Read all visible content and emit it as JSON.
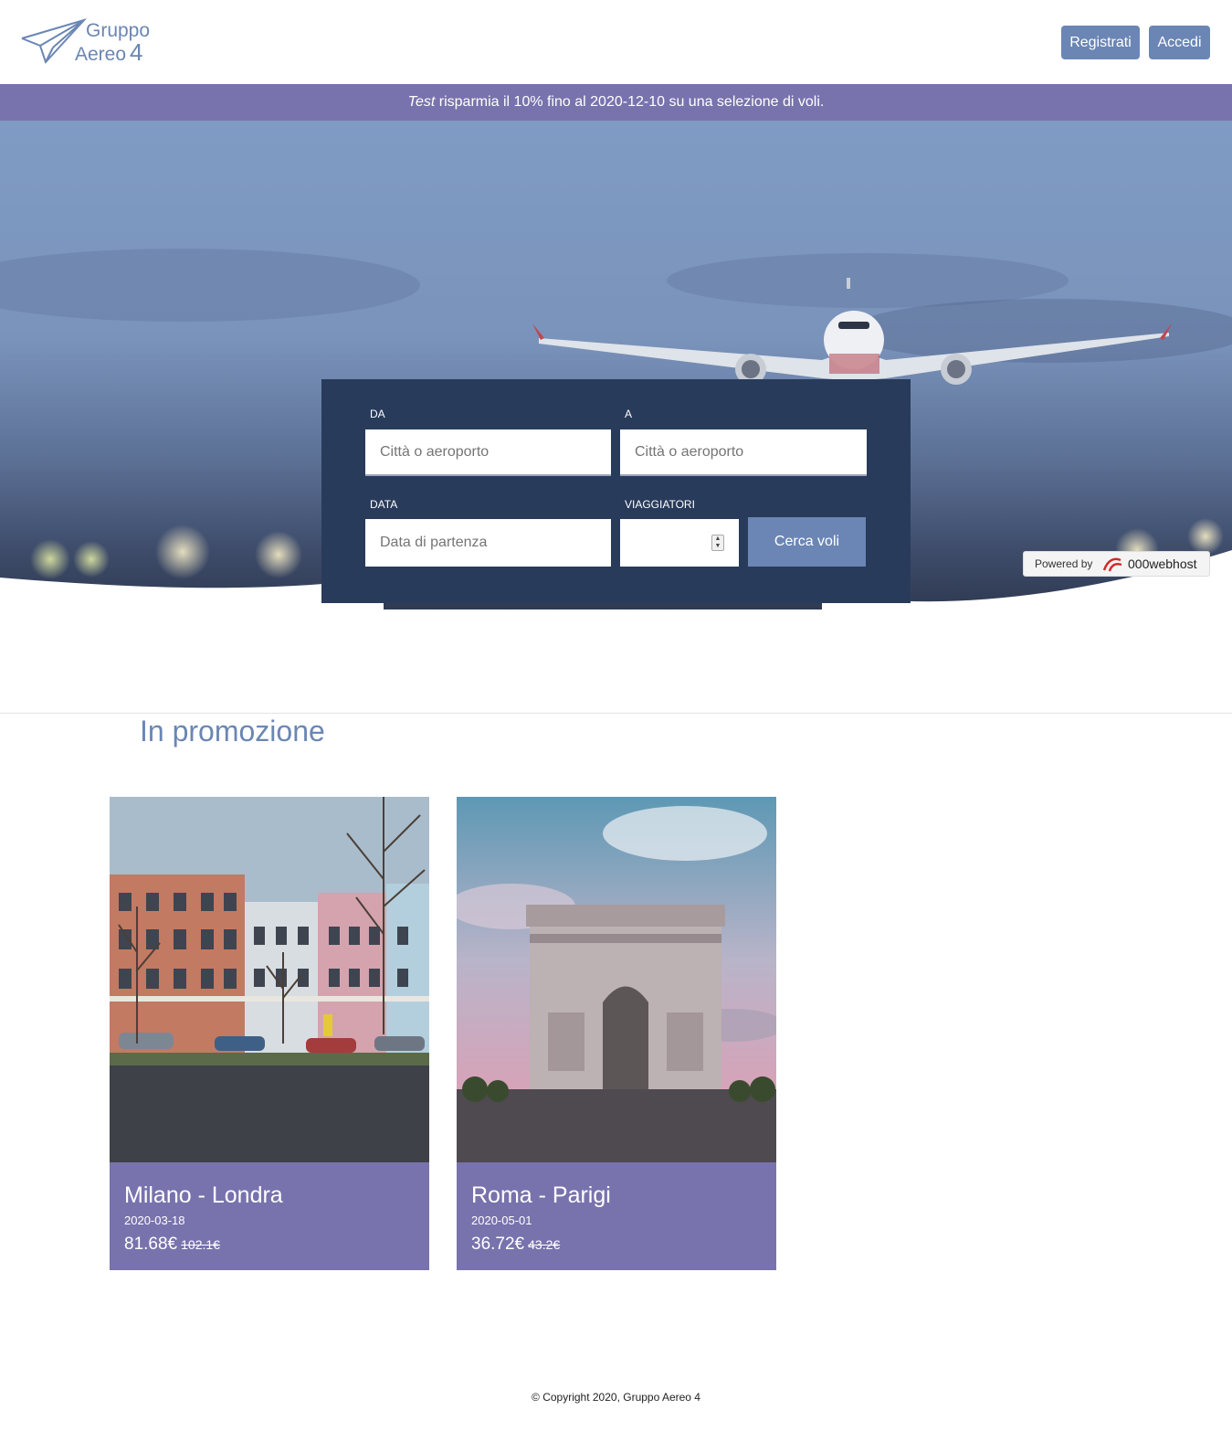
{
  "brand": {
    "line1": "Gruppo",
    "line2": "Aereo",
    "number": "4"
  },
  "header": {
    "register_label": "Registrati",
    "login_label": "Accedi"
  },
  "banner": {
    "highlight": "Test",
    "text": " risparmia il 10% fino al 2020-12-10 su una selezione di voli."
  },
  "search": {
    "from_label": "DA",
    "from_placeholder": "Città o aeroporto",
    "to_label": "A",
    "to_placeholder": "Città o aeroporto",
    "date_label": "DATA",
    "date_placeholder": "Data di partenza",
    "travelers_label": "VIAGGIATORI",
    "travelers_value": "",
    "submit_label": "Cerca voli"
  },
  "powered": {
    "prefix": "Powered by",
    "brand": "000webhost"
  },
  "promo": {
    "title": "In promozione",
    "cards": [
      {
        "route": "Milano - Londra",
        "date": "2020-03-18",
        "price": "81.68€",
        "old_price": "102.1€"
      },
      {
        "route": "Roma - Parigi",
        "date": "2020-05-01",
        "price": "36.72€",
        "old_price": "43.2€"
      }
    ]
  },
  "footer": {
    "copyright": "© Copyright 2020, Gruppo Aereo 4"
  }
}
